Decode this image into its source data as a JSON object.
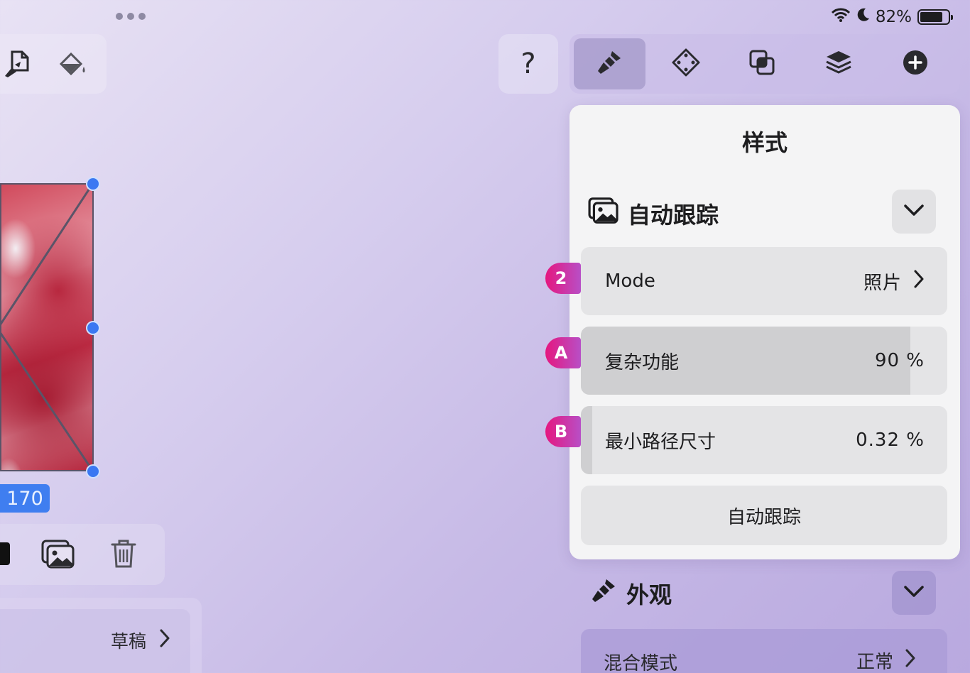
{
  "status_bar": {
    "battery_percent": "82%",
    "icons": [
      "wifi-icon",
      "moon-icon",
      "battery-icon"
    ]
  },
  "left_toolbar": {
    "icons": [
      "document-brush-icon",
      "paint-bucket-icon"
    ]
  },
  "top_toolbar": {
    "help_label": "?",
    "tabs": [
      "brush-style-icon",
      "transform-icon",
      "boolean-icon",
      "layers-icon",
      "add-icon"
    ],
    "active_tab": "brush-style-icon"
  },
  "canvas": {
    "dimension_label": "170"
  },
  "left_bottom_toolbar": {
    "icons": [
      "image-stack-icon",
      "trash-icon"
    ]
  },
  "left_panel": {
    "row_value": "草稿"
  },
  "style_panel": {
    "title": "样式",
    "section": {
      "title": "自动跟踪",
      "icon": "image-stack-icon",
      "rows": [
        {
          "badge": "2",
          "label": "Mode",
          "value": "照片",
          "has_chevron": true,
          "fill": 0
        },
        {
          "badge": "A",
          "label": "复杂功能",
          "value": "90 %",
          "has_chevron": false,
          "fill": 0.9
        },
        {
          "badge": "B",
          "label": "最小路径尺寸",
          "value": "0.32 %",
          "has_chevron": false,
          "fill": 0.0032
        }
      ],
      "action_label": "自动跟踪"
    }
  },
  "appearance": {
    "title": "外观",
    "blend_mode_label": "混合模式",
    "blend_mode_value": "正常"
  },
  "colors": {
    "accent_blue": "#3f7ef0",
    "badge_gradient_start": "#e5177f",
    "badge_gradient_end": "#b84fc6"
  }
}
